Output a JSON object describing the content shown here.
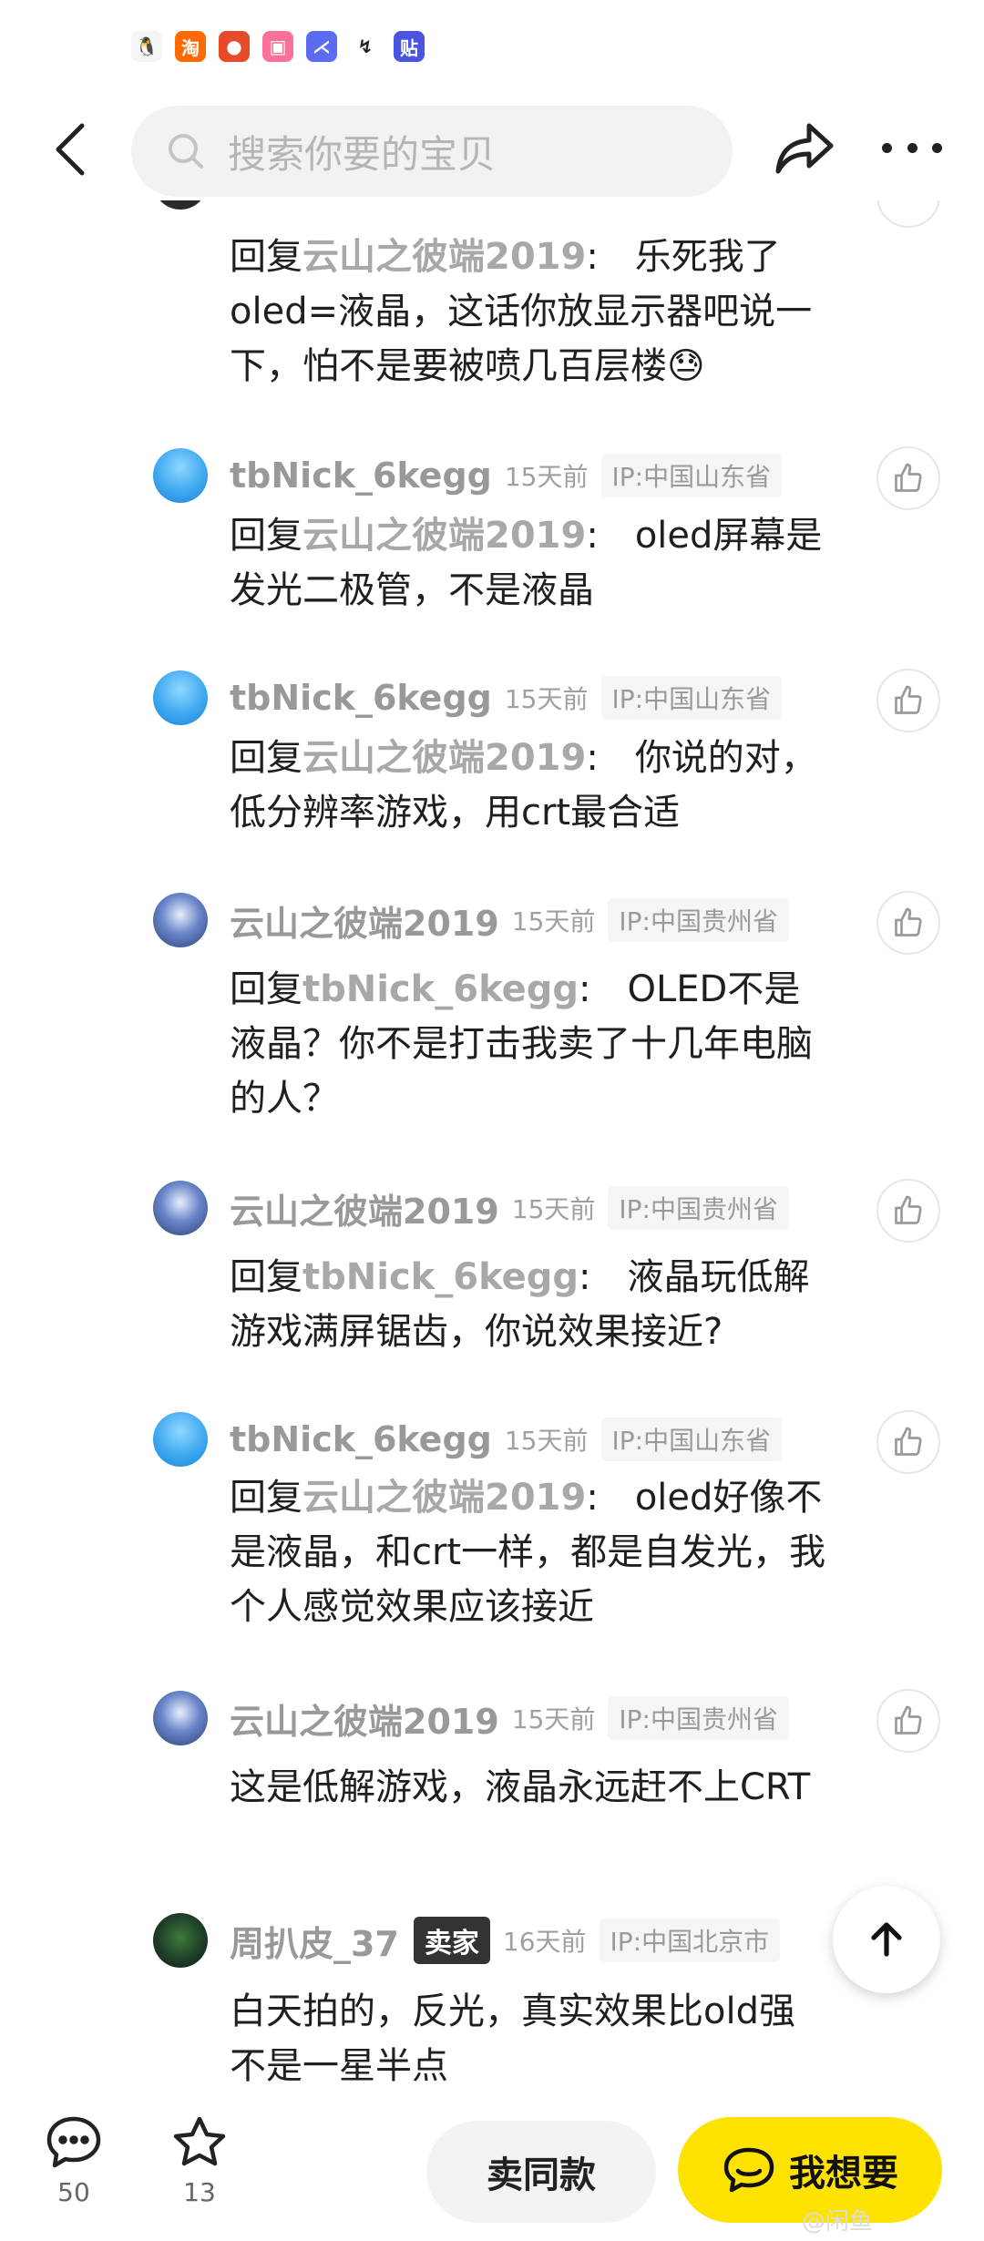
{
  "status_bar": {
    "icons": [
      {
        "name": "qq-icon",
        "glyph": "🐧",
        "color": "#ffffff"
      },
      {
        "name": "taobao-icon",
        "glyph": "淘",
        "color": "#ff6a00"
      },
      {
        "name": "game-icon",
        "glyph": "●",
        "color": "#e84b2a"
      },
      {
        "name": "bilibili-icon",
        "glyph": "▣",
        "color": "#fb7299"
      },
      {
        "name": "app-icon",
        "glyph": "⋌",
        "color": "#5b6cf0"
      },
      {
        "name": "app2-icon",
        "glyph": "↯",
        "color": "#222222"
      },
      {
        "name": "tieba-icon",
        "glyph": "贴",
        "color": "#4a54e0"
      }
    ]
  },
  "search": {
    "placeholder": "搜索你要的宝贝"
  },
  "comments": [
    {
      "reply_prefix": "回复",
      "reply_to": "云山之彼端2019",
      "body": "乐死我了oled=液晶，这话你放显示器吧说一下，怕不是要被喷几百层楼😓"
    },
    {
      "username": "tbNick_6kegg",
      "time": "15天前",
      "ip": "IP:中国山东省",
      "reply_prefix": "回复",
      "reply_to": "云山之彼端2019",
      "body": "oled屏幕是发光二极管，不是液晶"
    },
    {
      "username": "tbNick_6kegg",
      "time": "15天前",
      "ip": "IP:中国山东省",
      "reply_prefix": "回复",
      "reply_to": "云山之彼端2019",
      "body": "你说的对，低分辨率游戏，用crt最合适"
    },
    {
      "username": "云山之彼端2019",
      "time": "15天前",
      "ip": "IP:中国贵州省",
      "reply_prefix": "回复",
      "reply_to": "tbNick_6kegg",
      "body": "OLED不是液晶？你不是打击我卖了十几年电脑的人？"
    },
    {
      "username": "云山之彼端2019",
      "time": "15天前",
      "ip": "IP:中国贵州省",
      "reply_prefix": "回复",
      "reply_to": "tbNick_6kegg",
      "body": "液晶玩低解游戏满屏锯齿，你说效果接近?"
    },
    {
      "username": "tbNick_6kegg",
      "time": "15天前",
      "ip": "IP:中国山东省",
      "reply_prefix": "回复",
      "reply_to": "云山之彼端2019",
      "body": "oled好像不是液晶，和crt一样，都是自发光，我个人感觉效果应该接近"
    },
    {
      "username": "云山之彼端2019",
      "time": "15天前",
      "ip": "IP:中国贵州省",
      "body": "这是低解游戏，液晶永远赶不上CRT"
    },
    {
      "username": "周扒皮_37",
      "badge": "卖家",
      "time": "16天前",
      "ip": "IP:中国北京市",
      "body": "白天拍的，反光，真实效果比old强不是一星半点"
    }
  ],
  "bottom": {
    "comment_count": "50",
    "favorite_count": "13",
    "same_label": "卖同款",
    "want_label": "我想要",
    "watermark": "@闲鱼"
  },
  "colors": {
    "accent": "#ffe300",
    "username": "#999999",
    "seller_badge": "#333333"
  }
}
